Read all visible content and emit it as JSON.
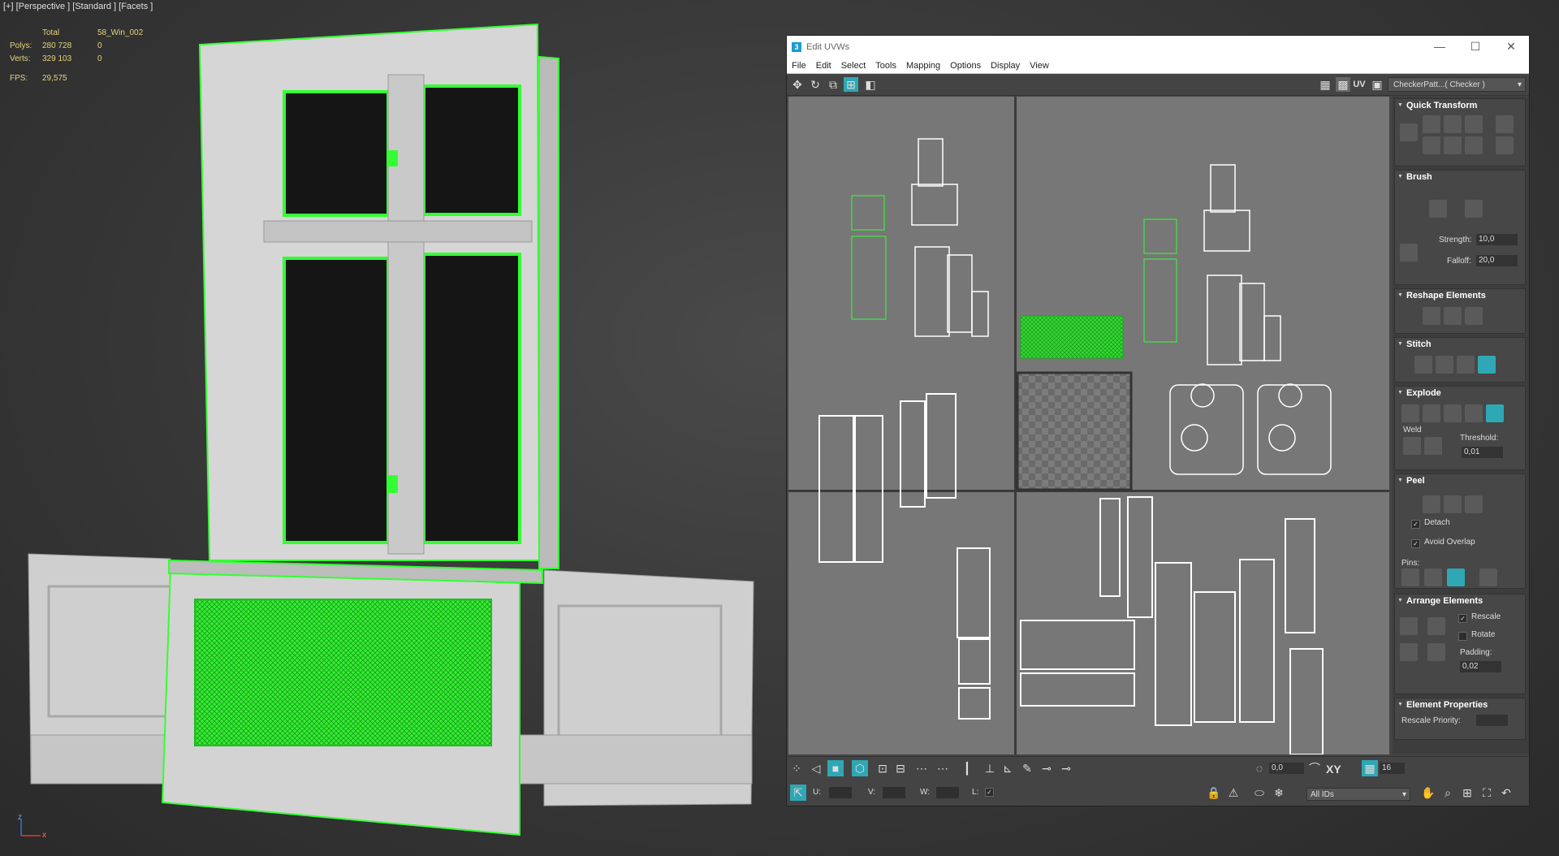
{
  "viewport": {
    "label": "[+] [Perspective ] [Standard ] [Facets ]",
    "stats": {
      "header": [
        "",
        "Total",
        "58_Win_002"
      ],
      "rows": [
        {
          "k": "Polys:",
          "total": "280 728",
          "sel": "0"
        },
        {
          "k": "Verts:",
          "total": "329 103",
          "sel": "0"
        }
      ],
      "fps_label": "FPS:",
      "fps_value": "29,575"
    },
    "axis_labels": {
      "z": "z",
      "x": "x"
    }
  },
  "uvw": {
    "title": "Edit UVWs",
    "app_icon": "3",
    "window_buttons": [
      "—",
      "☐",
      "✕"
    ],
    "menu": [
      "File",
      "Edit",
      "Select",
      "Tools",
      "Mapping",
      "Options",
      "Display",
      "View"
    ],
    "uv_label": "UV",
    "map_dropdown": "CheckerPatt...( Checker )",
    "rollouts": {
      "quick_transform": "Quick Transform",
      "brush": "Brush",
      "strength_label": "Strength:",
      "strength_value": "10,0",
      "falloff_label": "Falloff:",
      "falloff_value": "20,0",
      "reshape": "Reshape Elements",
      "stitch": "Stitch",
      "explode": "Explode",
      "weld_label": "Weld",
      "threshold_label": "Threshold:",
      "threshold_value": "0,01",
      "peel": "Peel",
      "detach_label": "Detach",
      "avoid_overlap_label": "Avoid Overlap",
      "pins_label": "Pins:",
      "arrange": "Arrange Elements",
      "rescale_label": "Rescale",
      "rotate_label": "Rotate",
      "padding_label": "Padding:",
      "padding_value": "0,02",
      "element_props": "Element Properties",
      "rescale_priority_label": "Rescale Priority:"
    },
    "bottom": {
      "angle_value": "0,0",
      "xy_label": "XY",
      "grid_value": "16",
      "u_label": "U:",
      "v_label": "V:",
      "w_label": "W:",
      "l_label": "L:",
      "ids_dropdown": "All IDs"
    }
  },
  "colors": {
    "accent_green": "#33ff33",
    "uv_background": "#777777",
    "panel_background": "#444444",
    "cyan_active": "#2fa7b5",
    "stats_text": "#e6d37a"
  }
}
